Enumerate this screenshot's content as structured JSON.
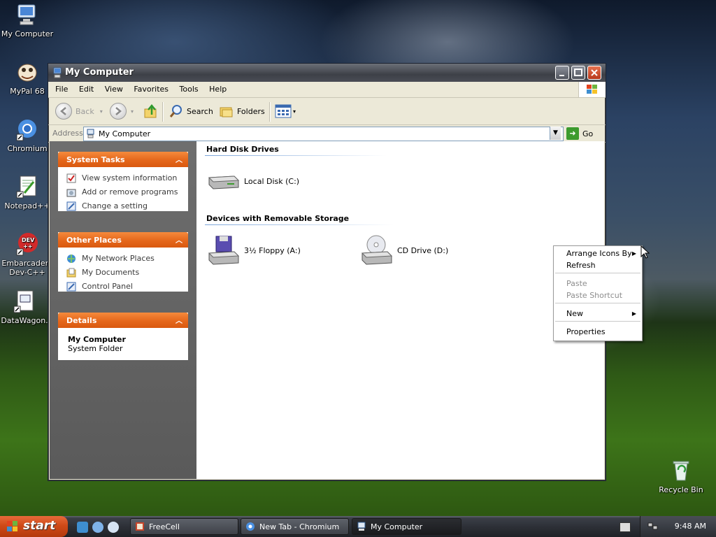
{
  "desktop": {
    "icons": [
      {
        "label": "My Computer"
      },
      {
        "label": "MyPal 68"
      },
      {
        "label": "Chromium"
      },
      {
        "label": "Notepad++"
      },
      {
        "label": "Embarcadero Dev-C++",
        "line1": "Embarcadero",
        "line2": "Dev-C++"
      },
      {
        "label": "DataWagon."
      },
      {
        "label": "Recycle Bin"
      }
    ]
  },
  "window": {
    "title": "My Computer",
    "menu": [
      "File",
      "Edit",
      "View",
      "Favorites",
      "Tools",
      "Help"
    ],
    "toolbar": {
      "back": "Back",
      "search": "Search",
      "folders": "Folders"
    },
    "address": {
      "label": "Address",
      "value": "My Computer",
      "go": "Go"
    },
    "panels": {
      "system_tasks": {
        "title": "System Tasks",
        "items": [
          "View system information",
          "Add or remove programs",
          "Change a setting"
        ]
      },
      "other_places": {
        "title": "Other Places",
        "items": [
          "My Network Places",
          "My Documents",
          "Control Panel"
        ]
      },
      "details": {
        "title": "Details",
        "name": "My Computer",
        "type": "System Folder"
      }
    },
    "groups": {
      "hard_disks": {
        "title": "Hard Disk Drives",
        "items": [
          "Local Disk (C:)"
        ]
      },
      "removable": {
        "title": "Devices with Removable Storage",
        "items": [
          "3½ Floppy (A:)",
          "CD Drive (D:)"
        ]
      }
    }
  },
  "context_menu": {
    "items": [
      {
        "label": "Arrange Icons By",
        "submenu": true
      },
      {
        "label": "Refresh"
      },
      {
        "label": "Paste",
        "disabled": true
      },
      {
        "label": "Paste Shortcut",
        "disabled": true
      },
      {
        "label": "New",
        "submenu": true
      },
      {
        "label": "Properties"
      }
    ]
  },
  "taskbar": {
    "start": "start",
    "tasks": [
      "FreeCell",
      "New Tab - Chromium",
      "My Computer"
    ],
    "clock": "9:48 AM"
  },
  "colors": {
    "panel_header": "#e5671b",
    "left_pane": "#636363",
    "title_bar": "#4d5058",
    "taskbar": "#2d3037"
  }
}
